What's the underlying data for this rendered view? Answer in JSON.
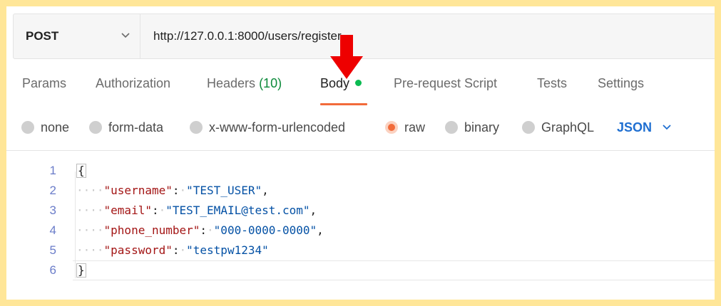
{
  "request": {
    "method": "POST",
    "url": "http://127.0.0.1:8000/users/register"
  },
  "tabs": [
    {
      "label": "Params"
    },
    {
      "label": "Authorization"
    },
    {
      "label": "Headers",
      "count": "(10)"
    },
    {
      "label": "Body",
      "active": true
    },
    {
      "label": "Pre-request Script"
    },
    {
      "label": "Tests"
    },
    {
      "label": "Settings"
    }
  ],
  "body_modes": [
    {
      "label": "none"
    },
    {
      "label": "form-data"
    },
    {
      "label": "x-www-form-urlencoded"
    },
    {
      "label": "raw",
      "selected": true
    },
    {
      "label": "binary"
    },
    {
      "label": "GraphQL"
    }
  ],
  "language": "JSON",
  "editor": {
    "lines": [
      {
        "n": "1",
        "text": "{"
      },
      {
        "n": "2",
        "key": "\"username\"",
        "value": "\"TEST_USER\"",
        "trail": ","
      },
      {
        "n": "3",
        "key": "\"email\"",
        "value": "\"TEST_EMAIL@test.com\"",
        "trail": ","
      },
      {
        "n": "4",
        "key": "\"phone_number\"",
        "value": "\"000-0000-0000\"",
        "trail": ","
      },
      {
        "n": "5",
        "key": "\"password\"",
        "value": "\"testpw1234\"",
        "trail": ""
      },
      {
        "n": "6",
        "text": "}"
      }
    ]
  },
  "colors": {
    "frame": "#ffe698",
    "accent": "#f26b3a",
    "arrow": "#ee0000",
    "body_dot": "#0cbb52",
    "language": "#1f6fd1"
  }
}
